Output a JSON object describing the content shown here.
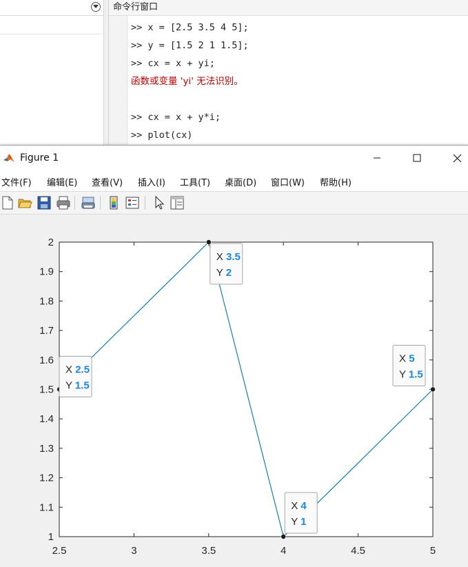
{
  "command_window": {
    "title": "命令行窗口",
    "lines": [
      {
        "text": ">> x = [2.5 3.5 4 5];",
        "type": "input"
      },
      {
        "text": ">> y = [1.5 2 1 1.5];",
        "type": "input"
      },
      {
        "text": ">> cx = x + yi;",
        "type": "input"
      },
      {
        "text": "函数或变量 'yi' 无法识别。",
        "type": "error"
      },
      {
        "text": "",
        "type": "blank"
      },
      {
        "text": ">> cx = x + y*i;",
        "type": "input"
      },
      {
        "text": ">> plot(cx)",
        "type": "input"
      }
    ]
  },
  "figure": {
    "title": "Figure 1",
    "menu": [
      "文件(F)",
      "编辑(E)",
      "查看(V)",
      "插入(I)",
      "工具(T)",
      "桌面(D)",
      "窗口(W)",
      "帮助(H)"
    ],
    "toolbar_icons": [
      "new-figure-icon",
      "open-file-icon",
      "save-icon",
      "print-icon",
      "link-plot-icon",
      "colorbar-icon",
      "legend-icon",
      "pointer-icon",
      "property-inspector-icon"
    ]
  },
  "colors": {
    "line": "#0072bd",
    "datatip_value": "#1a86e0",
    "error_text": "#c00000"
  },
  "chart_data": {
    "type": "line",
    "x": [
      2.5,
      3.5,
      4,
      5
    ],
    "y": [
      1.5,
      2,
      1,
      1.5
    ],
    "xlim": [
      2.5,
      5
    ],
    "ylim": [
      1,
      2
    ],
    "xticks": [
      "2.5",
      "3",
      "3.5",
      "4",
      "4.5",
      "5"
    ],
    "yticks": [
      "1",
      "1.1",
      "1.2",
      "1.3",
      "1.4",
      "1.5",
      "1.6",
      "1.7",
      "1.8",
      "1.9",
      "2"
    ],
    "grid": false,
    "datatips": [
      {
        "x_label": "X",
        "x_value": "2.5",
        "y_label": "Y",
        "y_value": "1.5"
      },
      {
        "x_label": "X",
        "x_value": "3.5",
        "y_label": "Y",
        "y_value": "2"
      },
      {
        "x_label": "X",
        "x_value": "4",
        "y_label": "Y",
        "y_value": "1"
      },
      {
        "x_label": "X",
        "x_value": "5",
        "y_label": "Y",
        "y_value": "1.5"
      }
    ]
  }
}
